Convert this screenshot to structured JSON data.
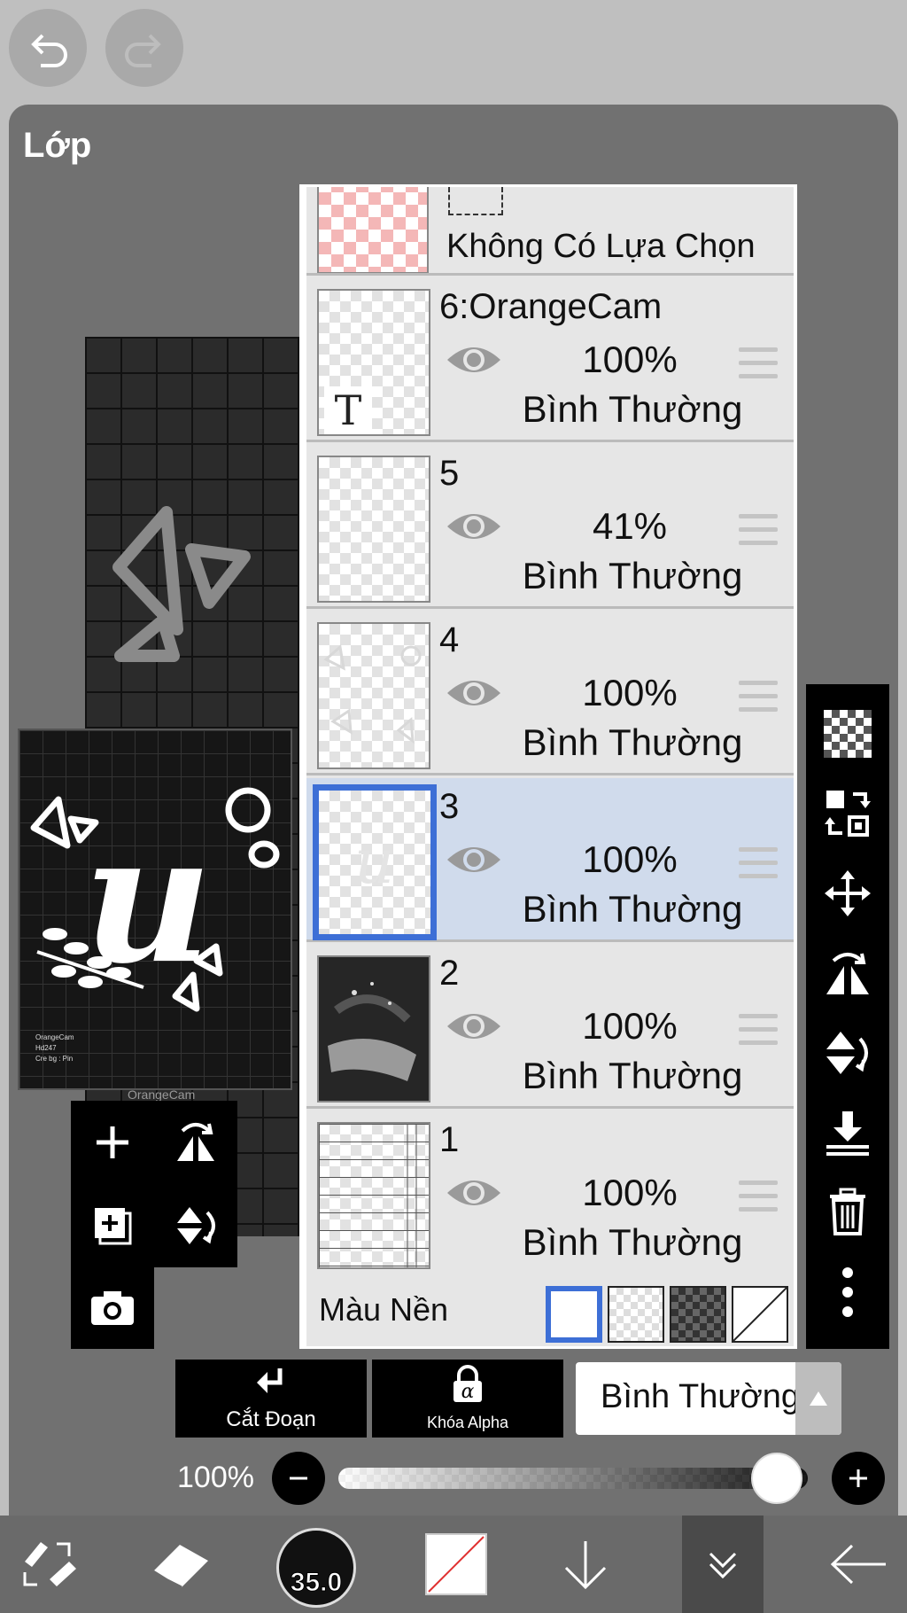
{
  "panel": {
    "title": "Lớp"
  },
  "selection_row": {
    "label": "Không Có Lựa Chọn"
  },
  "layers": [
    {
      "name": "6:OrangeCam",
      "opacity": "100%",
      "blend": "Bình Thường",
      "visible": true,
      "selected": false,
      "thumb_icon": "T"
    },
    {
      "name": "5",
      "opacity": "41%",
      "blend": "Bình Thường",
      "visible": true,
      "selected": false
    },
    {
      "name": "4",
      "opacity": "100%",
      "blend": "Bình Thường",
      "visible": true,
      "selected": false
    },
    {
      "name": "3",
      "opacity": "100%",
      "blend": "Bình Thường",
      "visible": true,
      "selected": true
    },
    {
      "name": "2",
      "opacity": "100%",
      "blend": "Bình Thường",
      "visible": true,
      "selected": false
    },
    {
      "name": "1",
      "opacity": "100%",
      "blend": "Bình Thường",
      "visible": true,
      "selected": false
    }
  ],
  "background_row": {
    "label": "Màu Nền"
  },
  "preview": {
    "credit_lines": [
      "OrangeCam",
      "Hd247",
      "Cre bg : Pin"
    ],
    "caption": "OrangeCam",
    "letter": "u"
  },
  "actions": {
    "clip_label": "Cắt Đoạn",
    "alpha_lock_label": "Khóa Alpha",
    "alpha_symbol": "α"
  },
  "blend_select": {
    "value": "Bình Thường"
  },
  "layer_opacity": {
    "label": "100%",
    "value_percent": 100
  },
  "brush": {
    "size": "35.0"
  },
  "colors": {
    "accent": "#3d6fd6",
    "selected_row": "#d0dbec",
    "panel": "#717171"
  }
}
